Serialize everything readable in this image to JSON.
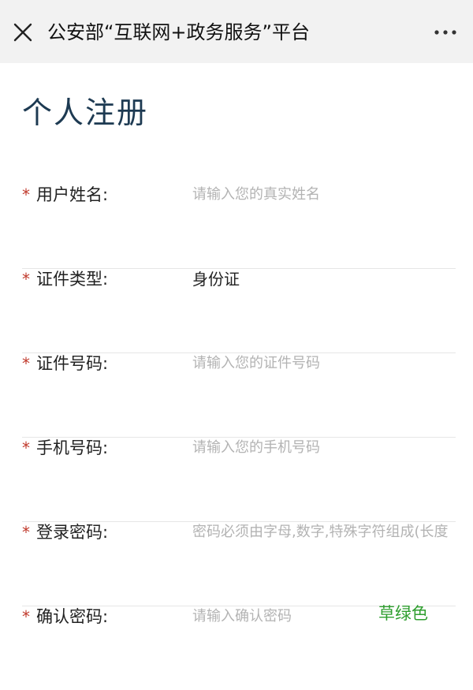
{
  "header": {
    "title": "公安部“互联网+政务服务”平台",
    "close_icon": "close-icon",
    "more_icon": "more-icon"
  },
  "page": {
    "heading": "个人注册"
  },
  "form": {
    "required_mark": "*",
    "fields": [
      {
        "label": "用户姓名:",
        "placeholder": "请输入您的真实姓名",
        "value": ""
      },
      {
        "label": "证件类型:",
        "placeholder": "",
        "value": "身份证"
      },
      {
        "label": "证件号码:",
        "placeholder": "请输入您的证件号码",
        "value": ""
      },
      {
        "label": "手机号码:",
        "placeholder": "请输入您的手机号码",
        "value": ""
      },
      {
        "label": "登录密码:",
        "placeholder": "密码必须由字母,数字,特殊字符组成(长度",
        "value": ""
      },
      {
        "label": "确认密码:",
        "placeholder": "请输入确认密码",
        "value": ""
      }
    ]
  },
  "watermark": {
    "text": "草绿色"
  },
  "colors": {
    "header_bg": "#f2f2f2",
    "heading": "#1d3a52",
    "required": "#c0392b",
    "placeholder": "#b3b3b3",
    "watermark": "#2e9e2e"
  }
}
